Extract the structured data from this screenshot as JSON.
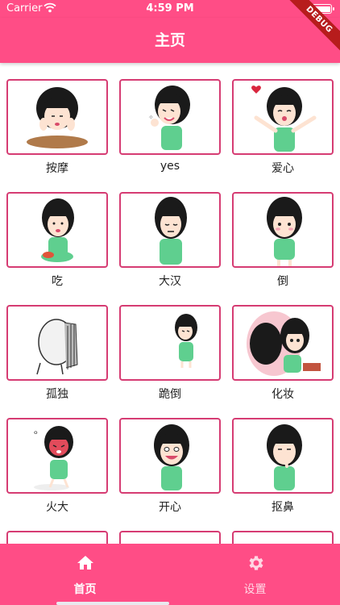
{
  "status_bar": {
    "carrier": "Carrier",
    "time": "4:59 PM"
  },
  "app_bar": {
    "title": "主页"
  },
  "debug_banner": "DEBUG",
  "grid": {
    "items": [
      {
        "label": "按摩"
      },
      {
        "label": "yes"
      },
      {
        "label": "爱心"
      },
      {
        "label": "吃"
      },
      {
        "label": "大汉"
      },
      {
        "label": "倒"
      },
      {
        "label": "孤独"
      },
      {
        "label": "跪倒"
      },
      {
        "label": "化妆"
      },
      {
        "label": "火大"
      },
      {
        "label": "开心"
      },
      {
        "label": "抠鼻"
      }
    ]
  },
  "bottom_nav": {
    "items": [
      {
        "label": "首页",
        "icon": "home-icon",
        "active": true
      },
      {
        "label": "设置",
        "icon": "settings-gear-icon",
        "active": false
      }
    ]
  },
  "colors": {
    "primary": "#ff4d86",
    "card_border": "#d63c73",
    "hair": "#1a1a1a",
    "skin": "#fde3d2",
    "shirt": "#5fcf8f"
  }
}
